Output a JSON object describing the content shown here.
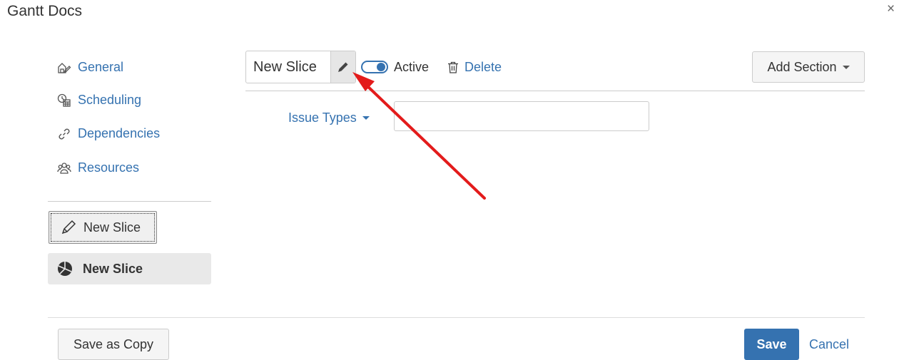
{
  "dialog": {
    "title": "Gantt Docs",
    "close_icon": "×"
  },
  "sidebar": {
    "items": [
      {
        "label": "General",
        "icon": "general-settings-icon"
      },
      {
        "label": "Scheduling",
        "icon": "calendar-clock-icon"
      },
      {
        "label": "Dependencies",
        "icon": "link-icon"
      },
      {
        "label": "Resources",
        "icon": "people-icon"
      }
    ],
    "new_slice_button": "New Slice",
    "slices": [
      {
        "label": "New Slice",
        "icon": "pie-chart-icon"
      }
    ]
  },
  "slice_editor": {
    "name": "New Slice",
    "active_label": "Active",
    "active": true,
    "delete_label": "Delete",
    "add_section_label": "Add Section",
    "issue_types_label": "Issue Types",
    "issue_types_value": ""
  },
  "footer": {
    "save_as_copy": "Save as Copy",
    "save": "Save",
    "cancel": "Cancel"
  },
  "colors": {
    "link": "#3572b0",
    "primary": "#3572b0",
    "annotation_arrow": "#e31b1b"
  }
}
